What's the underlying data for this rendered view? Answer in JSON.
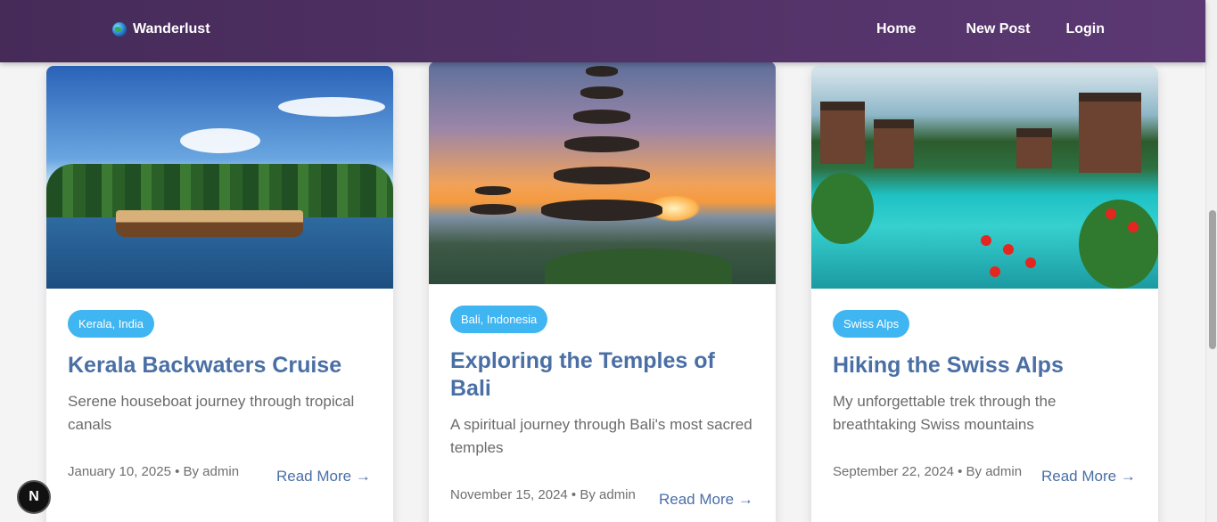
{
  "navbar": {
    "brand": "Wanderlust",
    "brand_icon": "globe-icon",
    "links": [
      "Home",
      "New Post",
      "Login"
    ]
  },
  "colors": {
    "navbar": "#4e2f63",
    "accent": "#3fb5f1",
    "title": "#4a6fa5",
    "background": "#f4f4f5"
  },
  "posts": [
    {
      "tag": "Kerala, India",
      "title": "Kerala Backwaters Cruise",
      "description": "Serene houseboat journey through tropical canals",
      "meta": "January 10, 2025 • By admin",
      "read_more": "Read More →",
      "image": "houseboat on backwaters with palm trees"
    },
    {
      "tag": "Bali, Indonesia",
      "title": "Exploring the Temples of Bali",
      "description": "A spiritual journey through Bali's most sacred temples",
      "meta": "November 15, 2024 • By admin",
      "read_more": "Read More →",
      "image": "pagoda temple at sunset by a lake"
    },
    {
      "tag": "Swiss Alps",
      "title": "Hiking the Swiss Alps",
      "description": "My unforgettable trek through the breathtaking Swiss mountains",
      "meta": "September 22, 2024 • By admin",
      "read_more": "Read More →",
      "image": "turquoise alpine lake with chalets and red flowers"
    }
  ],
  "dev_badge": "N"
}
